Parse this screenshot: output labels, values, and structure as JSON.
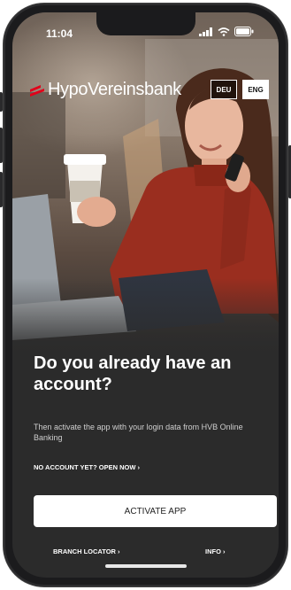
{
  "status_bar": {
    "time": "11:04"
  },
  "header": {
    "brand_name": "HypoVereinsbank",
    "language_options": [
      "DEU",
      "ENG"
    ],
    "selected_language": "ENG"
  },
  "main": {
    "headline": "Do you already have an account?",
    "subtext": "Then activate the app with your login data from HVB Online Banking",
    "open_account_link": "NO ACCOUNT YET? OPEN NOW ›",
    "activate_button": "ACTIVATE APP"
  },
  "footer": {
    "branch_locator": "BRANCH LOCATOR ›",
    "info": "INFO ›"
  },
  "colors": {
    "brand_red": "#e2001a",
    "background": "#2b2b2b"
  },
  "icons": [
    "signal-icon",
    "wifi-icon",
    "battery-icon",
    "hvb-logo-mark"
  ]
}
